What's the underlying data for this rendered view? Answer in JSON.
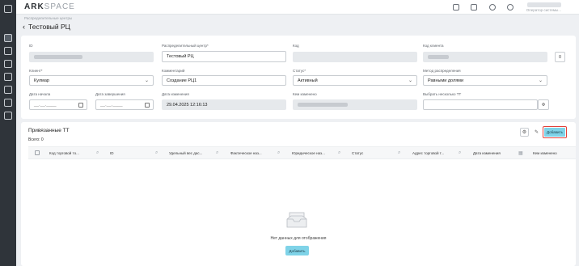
{
  "app": {
    "logo_main": "ARK",
    "logo_accent": "SPACE"
  },
  "header": {
    "user_role": "Оператор системы..."
  },
  "breadcrumb": "Распределительные центры",
  "page": {
    "title": "Тестовый РЦ"
  },
  "form": {
    "id": {
      "label": "ID",
      "value": ""
    },
    "dc_name": {
      "label": "Распределительный центр*",
      "value": "Тестовый РЦ"
    },
    "code": {
      "label": "Код",
      "value": ""
    },
    "client_code": {
      "label": "Код клиента",
      "value": ""
    },
    "client": {
      "label": "Клиент*",
      "value": "Кулмар"
    },
    "comment": {
      "label": "Комментарий",
      "value": "Создание РЦ1"
    },
    "status": {
      "label": "Статус*",
      "value": "Активный"
    },
    "dist_method": {
      "label": "Метод распределения",
      "value": "Равными долями"
    },
    "start_date": {
      "label": "Дата начала",
      "value": "__.__.____"
    },
    "end_date": {
      "label": "Дата завершения",
      "value": "__.__.____"
    },
    "modified_date": {
      "label": "Дата изменения",
      "value": "29.04.2025 12:16:13"
    },
    "modified_by": {
      "label": "Кем изменено",
      "value": ""
    },
    "select_tt": {
      "label": "Выбрать несколько ТТ",
      "value": ""
    },
    "code_btn": "0",
    "select_btn": "Ф"
  },
  "linked": {
    "title": "Привязанные ТТ",
    "total": "Всего: 0",
    "add_label": "Добавить",
    "columns": [
      "Код торговой то...",
      "ID",
      "Удельный вес дас...",
      "Фактическое наз...",
      "Юридическое наз...",
      "Статус",
      "Адрес торговой т...",
      "Дата изменения",
      "Кем изменено"
    ],
    "empty_text": "Нет данных для отображения",
    "empty_add_label": "Добавить"
  },
  "icons": {
    "sidebar": [
      "menu-icon",
      "home-icon",
      "docs-icon",
      "store-icon",
      "list-icon",
      "chart-icon",
      "settings-icon",
      "report-icon"
    ],
    "topbar": [
      "copy-icon",
      "grid-icon",
      "bell-icon",
      "compass-icon"
    ]
  },
  "colors": {
    "accent_button": "#7fd3e8",
    "highlight_border": "#e3413b",
    "sidebar_bg": "#2f343a"
  }
}
